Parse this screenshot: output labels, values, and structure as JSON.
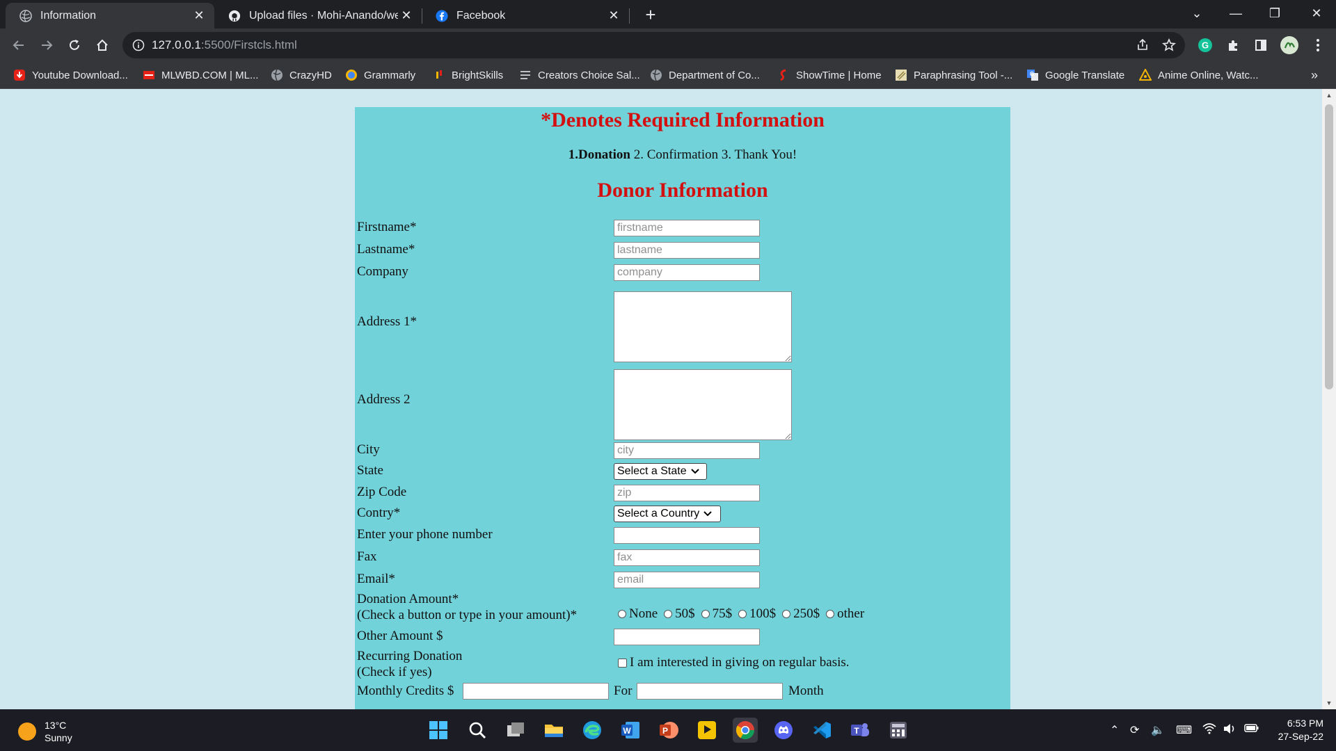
{
  "browser": {
    "tabs": [
      {
        "title": "Information",
        "icon": "globe-icon",
        "active": true
      },
      {
        "title": "Upload files · Mohi-Anando/web",
        "icon": "github-icon",
        "active": false
      },
      {
        "title": "Facebook",
        "icon": "facebook-icon",
        "active": false
      }
    ],
    "address": {
      "host": "127.0.0.1",
      "path": ":5500/Firstcls.html"
    },
    "bookmarks": [
      {
        "label": "Youtube Download...",
        "icon": "youtube-download-icon",
        "color": "#e62117"
      },
      {
        "label": "MLWBD.COM | ML...",
        "icon": "mlwbd-icon",
        "color": "#e62117"
      },
      {
        "label": "CrazyHD",
        "icon": "globe-icon",
        "color": "#9aa0a6"
      },
      {
        "label": "Grammarly",
        "icon": "grammarly-icon",
        "color": "#15c39a"
      },
      {
        "label": "BrightSkills",
        "icon": "brightskills-icon",
        "color": "#f4b400"
      },
      {
        "label": "Creators Choice Sal...",
        "icon": "creators-icon",
        "color": "#9aa0a6"
      },
      {
        "label": "Department of Co...",
        "icon": "globe-icon",
        "color": "#9aa0a6"
      },
      {
        "label": "ShowTime | Home",
        "icon": "showtime-icon",
        "color": "#e62117"
      },
      {
        "label": "Paraphrasing Tool -...",
        "icon": "paraphrase-icon",
        "color": "#c9b36b"
      },
      {
        "label": "Google Translate",
        "icon": "translate-icon",
        "color": "#4285f4"
      },
      {
        "label": "Anime Online, Watc...",
        "icon": "anime-icon",
        "color": "#f4b400"
      }
    ],
    "overflow": "»"
  },
  "form": {
    "required_note": "*Denotes Required Information",
    "steps": {
      "current": "1.Donation",
      "rest": " 2. Confirmation 3. Thank You!"
    },
    "section_title": "Donor Information",
    "fields": {
      "firstname": {
        "label": "Firstname*",
        "placeholder": "firstname"
      },
      "lastname": {
        "label": "Lastname*",
        "placeholder": "lastname"
      },
      "company": {
        "label": "Company",
        "placeholder": "company"
      },
      "address1": {
        "label": "Address 1*"
      },
      "address2": {
        "label": "Address 2"
      },
      "city": {
        "label": "City",
        "placeholder": "city"
      },
      "state": {
        "label": "State",
        "selected": "Select a State"
      },
      "zip": {
        "label": "Zip Code",
        "placeholder": "zip"
      },
      "country": {
        "label": "Contry*",
        "selected": "Select a Country"
      },
      "phone": {
        "label": "Enter your phone number",
        "placeholder": ""
      },
      "fax": {
        "label": "Fax",
        "placeholder": "fax"
      },
      "email": {
        "label": "Email*",
        "placeholder": "email"
      },
      "donation": {
        "label": "Donation Amount*",
        "sublabel": "(Check a button or type in your amount)*",
        "options": [
          "None",
          "50$",
          "75$",
          "100$",
          "250$",
          "other"
        ]
      },
      "other_amount": {
        "label": "Other Amount $"
      },
      "recurring": {
        "label": "Recurring Donation",
        "sublabel": "(Check if yes)",
        "checkbox_label": "I am interested in giving on regular basis."
      },
      "monthly": {
        "label": "Monthly Credits $",
        "for": "For",
        "month": "Month"
      }
    }
  },
  "taskbar": {
    "weather": {
      "temp": "13°C",
      "condition": "Sunny"
    },
    "clock": {
      "time": "6:53 PM",
      "date": "27-Sep-22"
    },
    "apps": [
      "windows-start-icon",
      "search-icon",
      "task-view-icon",
      "file-explorer-icon",
      "edge-icon",
      "word-icon",
      "powerpoint-icon",
      "media-player-icon",
      "chrome-icon",
      "discord-icon",
      "vscode-icon",
      "teams-icon",
      "calculator-icon"
    ]
  }
}
